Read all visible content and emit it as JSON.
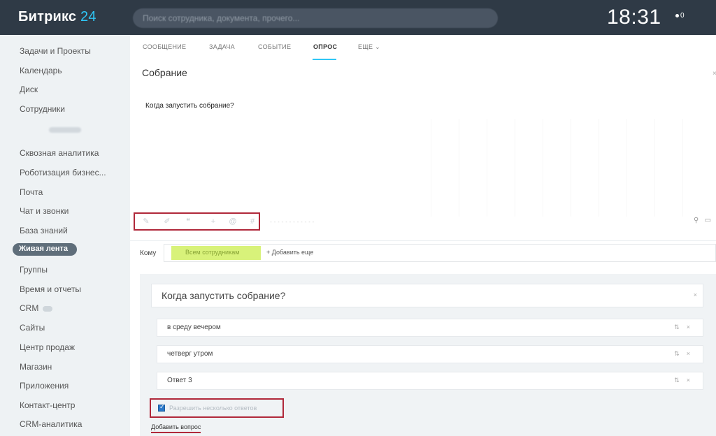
{
  "header": {
    "logo_main": "Битрикс",
    "logo_accent": "24",
    "search_placeholder": "Поиск сотрудника, документа, прочего...",
    "time": "18:31",
    "indicator": "0"
  },
  "sidebar": {
    "items": [
      {
        "label": "Задачи и Проекты"
      },
      {
        "label": "Календарь"
      },
      {
        "label": "Диск"
      },
      {
        "label": "Сотрудники"
      },
      {
        "label": "Сквозная аналитика"
      },
      {
        "label": "Роботизация бизнес..."
      },
      {
        "label": "Почта"
      },
      {
        "label": "Чат и звонки"
      },
      {
        "label": "База знаний"
      },
      {
        "label": "Живая лента"
      },
      {
        "label": "Группы"
      },
      {
        "label": "Время и отчеты"
      },
      {
        "label": "CRM"
      },
      {
        "label": "Сайты"
      },
      {
        "label": "Центр продаж"
      },
      {
        "label": "Магазин"
      },
      {
        "label": "Приложения"
      },
      {
        "label": "Контакт-центр"
      },
      {
        "label": "CRM-аналитика"
      }
    ]
  },
  "tabs": [
    {
      "label": "СООБЩЕНИЕ"
    },
    {
      "label": "ЗАДАЧА"
    },
    {
      "label": "СОБЫТИЕ"
    },
    {
      "label": "ОПРОС"
    },
    {
      "label": "ЕЩЕ"
    }
  ],
  "post": {
    "title": "Собрание",
    "body": "Когда запустить собрание?"
  },
  "recipients": {
    "label": "Кому",
    "chip": "Всем сотрудникам",
    "add_more": "+ Добавить еще"
  },
  "poll": {
    "question": "Когда запустить собрание?",
    "answers": [
      {
        "text": "в среду вечером"
      },
      {
        "text": "четверг утром"
      },
      {
        "text": "Ответ  3"
      }
    ],
    "multi_label": "Разрешить несколько ответов",
    "add_question": "Добавить вопрос"
  },
  "colors": {
    "topbar": "#2f3a46",
    "accent": "#2fc6f6",
    "highlight_box": "#b0283a",
    "chip": "#d8f27a"
  }
}
